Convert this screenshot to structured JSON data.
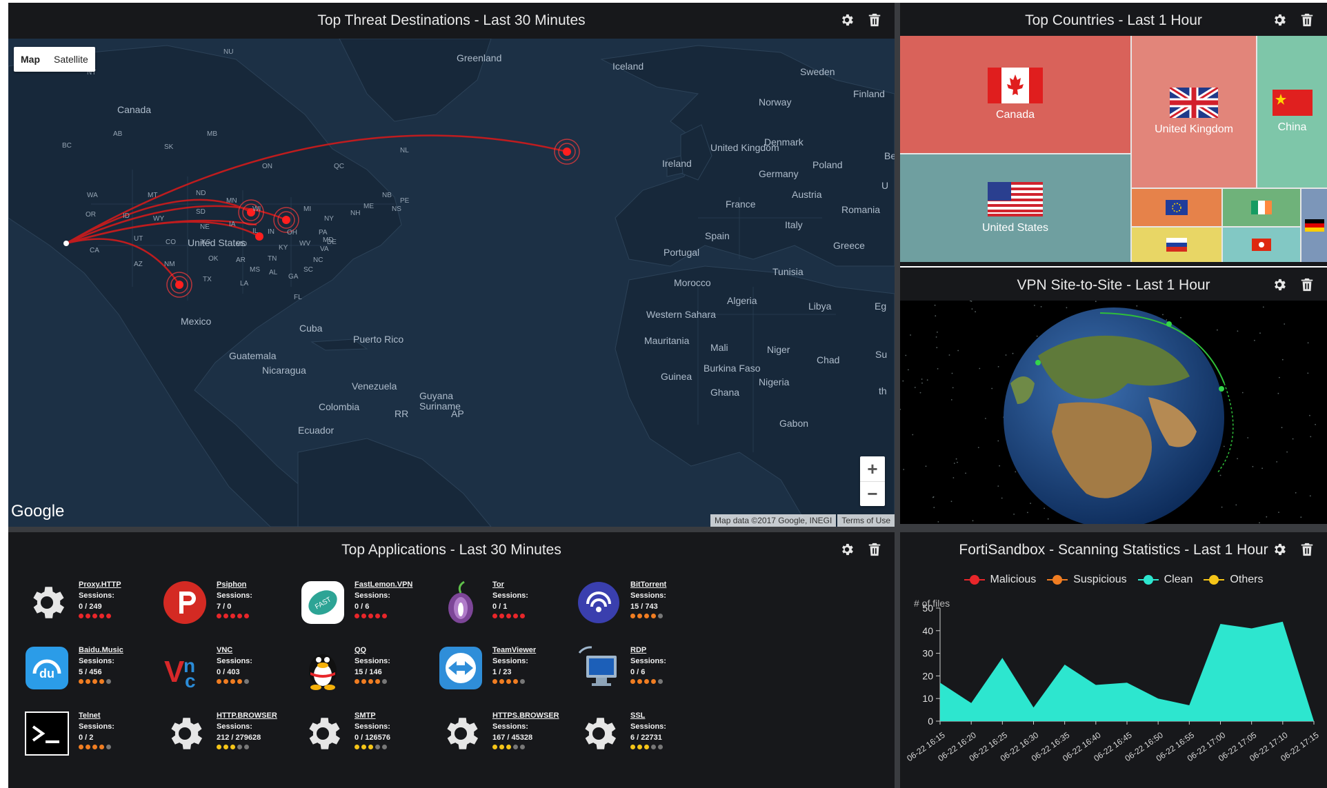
{
  "panels": {
    "threats": {
      "title": "Top Threat Destinations - Last 30 Minutes"
    },
    "countries": {
      "title": "Top Countries - Last 1 Hour"
    },
    "vpn": {
      "title": "VPN Site-to-Site - Last 1 Hour"
    },
    "apps": {
      "title": "Top Applications - Last 30 Minutes"
    },
    "sandbox": {
      "title": "FortiSandbox - Scanning Statistics - Last 1 Hour"
    }
  },
  "icons": {
    "settings": "gear-icon",
    "delete": "trash-icon"
  },
  "map": {
    "type_map": "Map",
    "type_satellite": "Satellite",
    "zoom_in": "+",
    "zoom_out": "−",
    "logo": "Google",
    "attribution": "Map data ©2017 Google, INEGI",
    "terms": "Terms of Use",
    "labels_large": [
      "Greenland",
      "Iceland",
      "Sweden",
      "Finland",
      "Norway",
      "Canada",
      "Denmark",
      "United Kingdom",
      "Ireland",
      "Belar",
      "Poland",
      "Germany",
      "Austria",
      "Romania",
      "France",
      "U",
      "Italy",
      "Spain",
      "Portugal",
      "Greece",
      "Tunisia",
      "Morocco",
      "Algeria",
      "Libya",
      "Eg",
      "Western Sahara",
      "Mauritania",
      "Mali",
      "Niger",
      "Chad",
      "Su",
      "Burkina Faso",
      "Guinea",
      "Nigeria",
      "Ghana",
      "Gabon",
      "th",
      "United States",
      "Mexico",
      "Cuba",
      "Puerto Rico",
      "Guatemala",
      "Nicaragua",
      "Venezuela",
      "Guyana",
      "Suriname",
      "Colombia",
      "Ecuador",
      "RR",
      "AP"
    ],
    "labels_small": [
      "NU",
      "NT",
      "AB",
      "MB",
      "BC",
      "SK",
      "ON",
      "QC",
      "NL",
      "NB",
      "PE",
      "NS",
      "WA",
      "MT",
      "ND",
      "MN",
      "WI",
      "MI",
      "ME",
      "OR",
      "ID",
      "SD",
      "NY",
      "NH",
      "WY",
      "NE",
      "IA",
      "IL",
      "IN",
      "OH",
      "PA",
      "UT",
      "CO",
      "KS",
      "MO",
      "KY",
      "WV",
      "MD",
      "DE",
      "VA",
      "CA",
      "AZ",
      "NM",
      "OK",
      "AR",
      "TN",
      "NC",
      "MS",
      "AL",
      "GA",
      "SC",
      "TX",
      "LA",
      "FL"
    ]
  },
  "countries": [
    {
      "name": "Canada",
      "flag": "flag-canada",
      "color": "#d9625a"
    },
    {
      "name": "United Kingdom",
      "flag": "flag-uk",
      "color": "#e2857a"
    },
    {
      "name": "China",
      "flag": "flag-china",
      "color": "#7ec6a9"
    },
    {
      "name": "United States",
      "flag": "flag-usa",
      "color": "#6f9fa0"
    }
  ],
  "apps": [
    {
      "name": "Proxy.HTTP",
      "label": "Sessions:",
      "sessions": "0 / 249",
      "icon": "gear-icon",
      "risk": 5
    },
    {
      "name": "Psiphon",
      "label": "Sessions:",
      "sessions": "7 / 0",
      "icon": "psiphon-icon",
      "risk": 5
    },
    {
      "name": "FastLemon.VPN",
      "label": "Sessions:",
      "sessions": "0 / 6",
      "icon": "fastlemon-icon",
      "risk": 5
    },
    {
      "name": "Tor",
      "label": "Sessions:",
      "sessions": "0 / 1",
      "icon": "tor-onion-icon",
      "risk": 5
    },
    {
      "name": "BitTorrent",
      "label": "Sessions:",
      "sessions": "15 / 743",
      "icon": "bittorrent-icon",
      "risk": 4
    },
    {
      "name": "Baidu.Music",
      "label": "Sessions:",
      "sessions": "5 / 456",
      "icon": "baidu-music-icon",
      "risk": 4
    },
    {
      "name": "VNC",
      "label": "Sessions:",
      "sessions": "0 / 403",
      "icon": "vnc-icon",
      "risk": 4
    },
    {
      "name": "QQ",
      "label": "Sessions:",
      "sessions": "15 / 146",
      "icon": "qq-penguin-icon",
      "risk": 4
    },
    {
      "name": "TeamViewer",
      "label": "Sessions:",
      "sessions": "1 / 23",
      "icon": "teamviewer-icon",
      "risk": 4
    },
    {
      "name": "RDP",
      "label": "Sessions:",
      "sessions": "0 / 6",
      "icon": "rdp-icon",
      "risk": 4
    },
    {
      "name": "Telnet",
      "label": "Sessions:",
      "sessions": "0 / 2",
      "icon": "terminal-icon",
      "risk": 4
    },
    {
      "name": "HTTP.BROWSER",
      "label": "Sessions:",
      "sessions": "212 / 279628",
      "icon": "gear-icon",
      "risk": 3
    },
    {
      "name": "SMTP",
      "label": "Sessions:",
      "sessions": "0 / 126576",
      "icon": "gear-icon",
      "risk": 3
    },
    {
      "name": "HTTPS.BROWSER",
      "label": "Sessions:",
      "sessions": "167 / 45328",
      "icon": "gear-icon",
      "risk": 3
    },
    {
      "name": "SSL",
      "label": "Sessions:",
      "sessions": "6 / 22731",
      "icon": "gear-icon",
      "risk": 3
    }
  ],
  "risk_colors": {
    "5": "#e8262a",
    "4": "#f07d22",
    "3": "#f5c518",
    "empty": "#777777"
  },
  "chart_data": {
    "type": "area",
    "ylabel": "# of files",
    "ylim": [
      0,
      50
    ],
    "yticks": [
      0,
      10,
      20,
      30,
      40,
      50
    ],
    "x": [
      "06-22 16:15",
      "06-22 16:20",
      "06-22 16:25",
      "06-22 16:30",
      "06-22 16:35",
      "06-22 16:40",
      "06-22 16:45",
      "06-22 16:50",
      "06-22 16:55",
      "06-22 17:00",
      "06-22 17:05",
      "06-22 17:10",
      "06-22 17:15"
    ],
    "series": [
      {
        "name": "Malicious",
        "color": "#e8262a",
        "values": [
          0,
          0,
          0,
          0,
          0,
          0,
          0,
          0,
          0,
          0,
          0,
          0,
          0
        ]
      },
      {
        "name": "Suspicious",
        "color": "#f07d22",
        "values": [
          0,
          0,
          0,
          0,
          0,
          0,
          0,
          0,
          0,
          0,
          0,
          0,
          0
        ]
      },
      {
        "name": "Clean",
        "color": "#2de6cf",
        "values": [
          17,
          8,
          28,
          6,
          25,
          16,
          17,
          10,
          7,
          43,
          41,
          44,
          0
        ]
      },
      {
        "name": "Others",
        "color": "#f5c518",
        "values": [
          0,
          0,
          0,
          0,
          0,
          0,
          0,
          0,
          0,
          0,
          0,
          0,
          0
        ]
      }
    ]
  }
}
